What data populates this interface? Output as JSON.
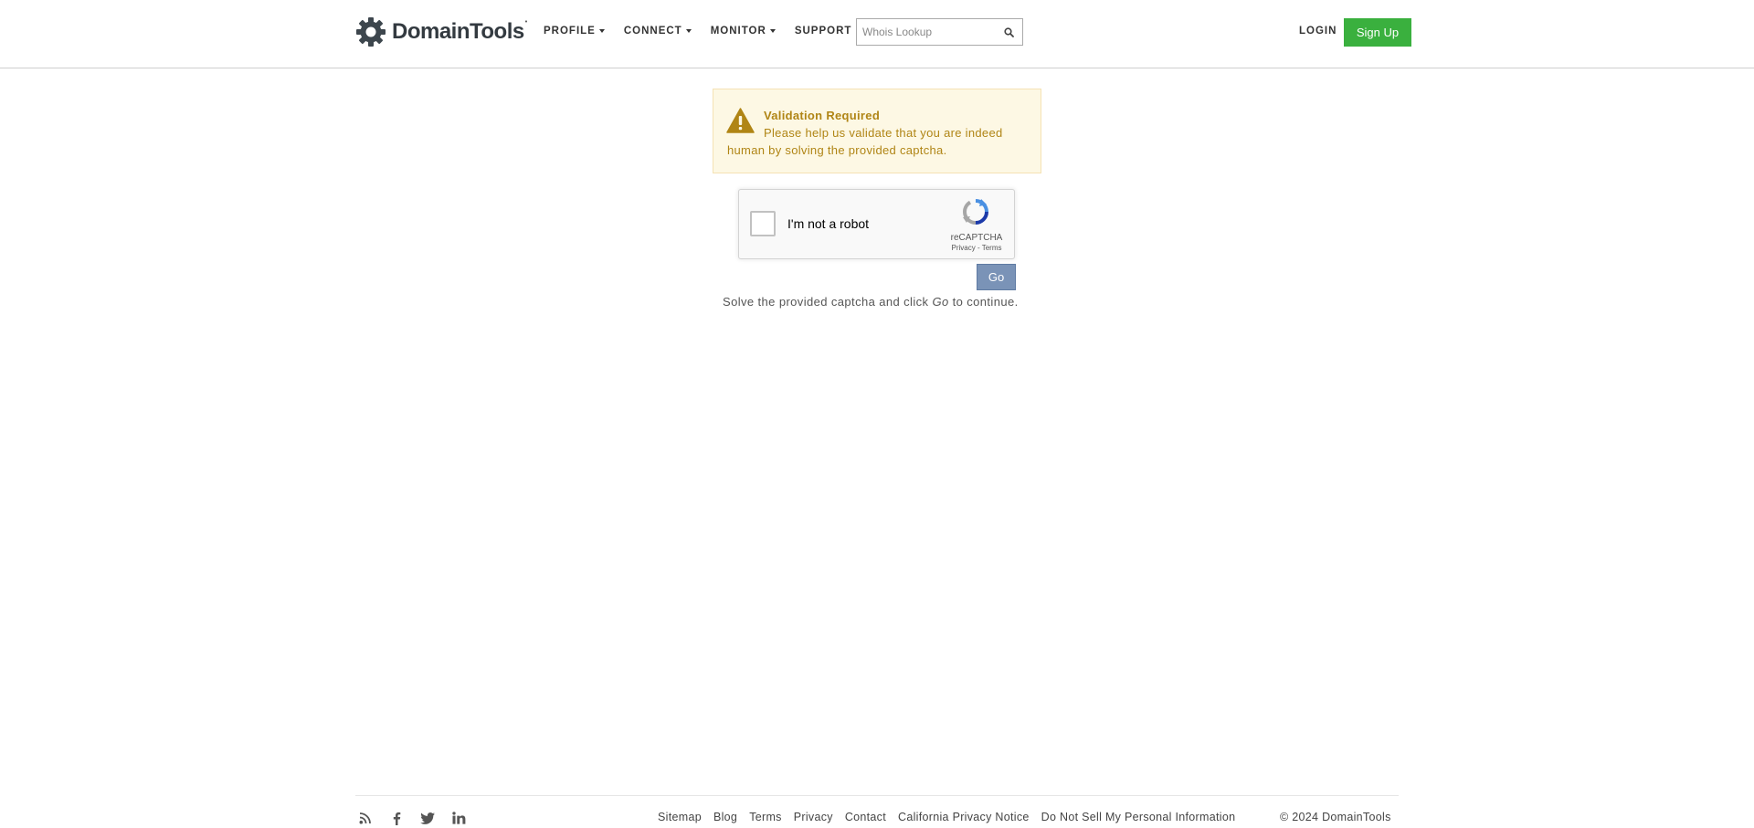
{
  "header": {
    "logo_text": "DomainTools",
    "nav": [
      {
        "label": "PROFILE",
        "dropdown": true
      },
      {
        "label": "CONNECT",
        "dropdown": true
      },
      {
        "label": "MONITOR",
        "dropdown": true
      },
      {
        "label": "SUPPORT",
        "dropdown": false
      }
    ],
    "search": {
      "placeholder": "Whois Lookup",
      "value": ""
    },
    "login_label": "LOGIN",
    "signup_label": "Sign Up"
  },
  "alert": {
    "title": "Validation Required",
    "message": "Please help us validate that you are indeed human by solving the provided captcha."
  },
  "captcha": {
    "label": "I'm not a robot",
    "brand": "reCAPTCHA",
    "privacy_label": "Privacy",
    "terms_label": "Terms"
  },
  "go_label": "Go",
  "hint": {
    "before": "Solve the provided captcha and click ",
    "emphasis": "Go",
    "after": " to continue."
  },
  "footer": {
    "social": [
      "rss-icon",
      "facebook-icon",
      "twitter-icon",
      "linkedin-icon"
    ],
    "links": [
      "Sitemap",
      "Blog",
      "Terms",
      "Privacy",
      "Contact",
      "California Privacy Notice",
      "Do Not Sell My Personal Information"
    ],
    "copyright": "© 2024 DomainTools"
  },
  "colors": {
    "signup": "#3ab03e",
    "go": "#7a93b7",
    "alert_bg": "#fdf8e4",
    "alert_text": "#b08515"
  }
}
